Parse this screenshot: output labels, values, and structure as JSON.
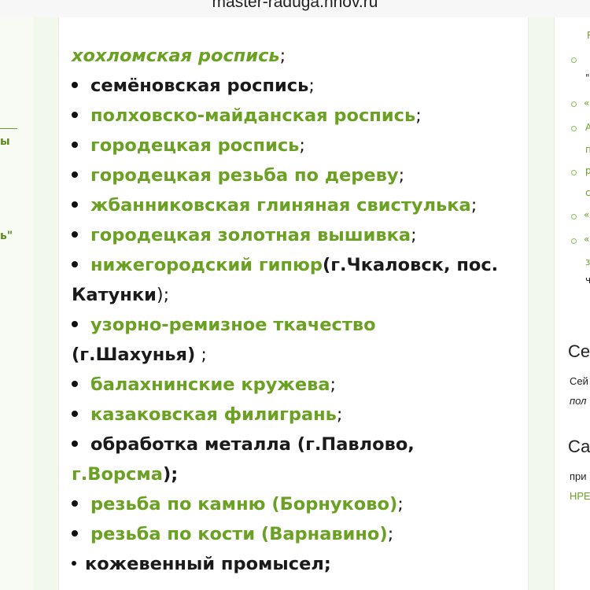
{
  "browser": {
    "url": "master-raduga.nnov.ru"
  },
  "left_sidebar": {
    "frag1": "ы",
    "frag2": "ь\""
  },
  "article": {
    "items": [
      {
        "text": "хохломская роспись",
        "suffix": ";"
      },
      {
        "text": "семёновская роспись",
        "suffix": ";"
      },
      {
        "text": "полховско-майданская роспись",
        "suffix": ";"
      },
      {
        "text": "городецкая роспись",
        "suffix": ";"
      },
      {
        "text": "городецкая резьба по дереву",
        "suffix": ";"
      },
      {
        "text": "жбанниковская глиняная свистулька",
        "suffix": ";"
      },
      {
        "text": "городецкая золотная вышивка",
        "suffix": ";"
      },
      {
        "text": "нижегородский гипюр",
        "extra": "(г.Чкаловск, пос.",
        "cont": "Катунки",
        "cont_suffix": ");"
      },
      {
        "text": "узорно-ремизное ткачество",
        "cont": "(г.Шахунья)",
        "cont_suffix": " ;"
      },
      {
        "text": "балахнинские кружева",
        "suffix": ";"
      },
      {
        "text": "казаковская филигрань",
        "suffix": ";"
      },
      {
        "text": "обработка металла (г.Павлово,",
        "cont": "г.Ворсма",
        "cont_suffix": ");"
      },
      {
        "text": "резьба по камню (Борнуково)",
        "suffix": ";"
      },
      {
        "text": "резьба по кости (Варнавино)",
        "suffix": ";"
      },
      {
        "text": "кожевенный промысел;"
      }
    ]
  },
  "right_sidebar": {
    "frag_r": "R",
    "frag_q1": "\"",
    "frag_quote": "«",
    "frag_a": "A",
    "frag_p": "п",
    "frag_r2": "р",
    "frag_c": "с",
    "frag_z": "з",
    "frag_ch": "ч",
    "heading1": "Се",
    "text1": "Сей",
    "text1b": "пол",
    "heading2": "Са",
    "text2": "при",
    "text2b": "НРЕ"
  },
  "colors": {
    "accent_green": "#6aa123",
    "text": "#1a1a1a"
  }
}
